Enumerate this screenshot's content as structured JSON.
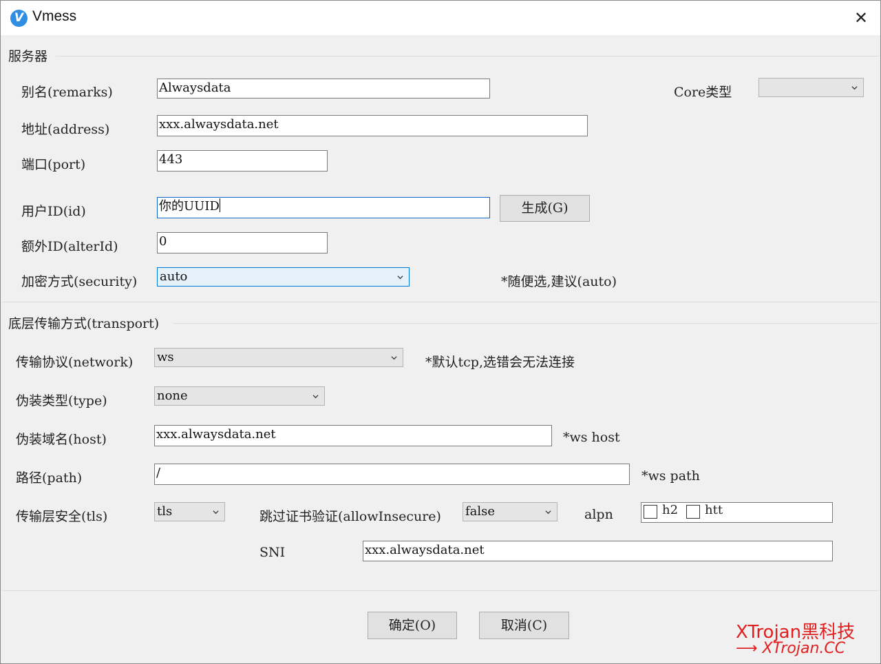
{
  "window": {
    "title": "Vmess",
    "icon": "v2rayn-app-icon",
    "close_glyph": "✕"
  },
  "server": {
    "section_title": "服务器",
    "remarks_label": "别名(remarks)",
    "remarks_value": "Alwaysdata",
    "core_type_label": "Core类型",
    "core_type_value": "",
    "address_label": "地址(address)",
    "address_value": "xxx.alwaysdata.net",
    "port_label": "端口(port)",
    "port_value": "443",
    "id_label": "用户ID(id)",
    "id_value": "你的UUID",
    "generate_button": "生成(G)",
    "alterid_label": "额外ID(alterId)",
    "alterid_value": "0",
    "security_label": "加密方式(security)",
    "security_value": "auto",
    "security_hint": "*随便选,建议(auto)"
  },
  "transport": {
    "section_title": "底层传输方式(transport)",
    "network_label": "传输协议(network)",
    "network_value": "ws",
    "network_hint": "*默认tcp,选错会无法连接",
    "type_label": "伪装类型(type)",
    "type_value": "none",
    "host_label": "伪装域名(host)",
    "host_value": "xxx.alwaysdata.net",
    "host_hint": "*ws host",
    "path_label": "路径(path)",
    "path_value": "/",
    "path_hint": "*ws path",
    "tls_label": "传输层安全(tls)",
    "tls_value": "tls",
    "allow_insecure_label": "跳过证书验证(allowInsecure)",
    "allow_insecure_value": "false",
    "alpn_label": "alpn",
    "alpn_options": [
      "h2",
      "htt"
    ],
    "sni_label": "SNI",
    "sni_value": "xxx.alwaysdata.net"
  },
  "footer": {
    "ok_button": "确定(O)",
    "cancel_button": "取消(C)"
  },
  "watermark": {
    "line1": "XTrojan黑科技",
    "line2": "XTrojan.CC",
    "arrow": "⟶",
    "color": "#e02020"
  },
  "colors": {
    "accent": "#0078d7",
    "dialog_bg": "#f0f0f0"
  }
}
